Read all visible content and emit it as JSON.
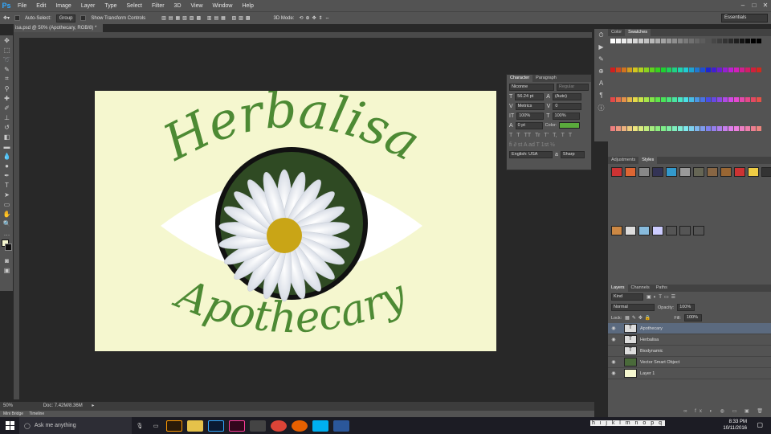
{
  "app": {
    "logo": "Ps",
    "menus": [
      "File",
      "Edit",
      "Image",
      "Layer",
      "Type",
      "Select",
      "Filter",
      "3D",
      "View",
      "Window",
      "Help"
    ]
  },
  "options": {
    "auto_select": "Auto-Select:",
    "group": "Group",
    "transform": "Show Transform Controls",
    "mode3d": "3D Mode:",
    "workspace": "Essentials"
  },
  "document": {
    "tab": "isa.psd @ 50% (Apothecary, RGB/8) *",
    "zoom": "50%",
    "doc_info": "Doc: 7.42M/8.36M"
  },
  "canvas": {
    "title": "Herbalisa",
    "subtitle": "Apothecary",
    "colors": {
      "background": "#f5f7cf",
      "text": "#4d8a34",
      "eye": "#ffffff",
      "ring": "#111111"
    }
  },
  "bottom_tabs": [
    "Mini Bridge",
    "Timeline"
  ],
  "color_panel": {
    "tabs": [
      "Color",
      "Swatches"
    ]
  },
  "styles_panel": {
    "tabs": [
      "Adjustments",
      "Styles"
    ]
  },
  "character": {
    "tabs": [
      "Character",
      "Paragraph"
    ],
    "font": "Niconne",
    "style": "Regular",
    "size": "56.24 pt",
    "leading": "(Auto)",
    "kerning": "Metrics",
    "tracking": "0",
    "vscale": "100%",
    "hscale": "100%",
    "baseline": "0 pt",
    "color_label": "Color:",
    "color": "#5aaa3c",
    "language": "English: USA",
    "aa": "Sharp",
    "glyphs": [
      "T",
      "T",
      "TT",
      "Tr",
      "T'",
      "T,",
      "T",
      "T"
    ]
  },
  "layers": {
    "tabs": [
      "Layers",
      "Channels",
      "Paths"
    ],
    "kind": "Kind",
    "blend": "Normal",
    "opacity_label": "Opacity:",
    "opacity": "100%",
    "lock_label": "Lock:",
    "fill_label": "Fill:",
    "fill": "100%",
    "items": [
      {
        "name": "Apothecary",
        "type": "T",
        "selected": true,
        "visible": true
      },
      {
        "name": "Herbalisa",
        "type": "fx",
        "selected": false,
        "visible": true
      },
      {
        "name": "Biodynamic",
        "type": "T",
        "selected": false,
        "visible": false
      },
      {
        "name": "Vector Smart Object",
        "type": "img",
        "selected": false,
        "visible": true
      },
      {
        "name": "Layer 1",
        "type": "fill",
        "selected": false,
        "visible": true
      }
    ]
  },
  "taskbar": {
    "search": "Ask me anything",
    "time": "8:33 PM",
    "date": "10/11/2016",
    "letters": "h i j k l m n o p q"
  }
}
